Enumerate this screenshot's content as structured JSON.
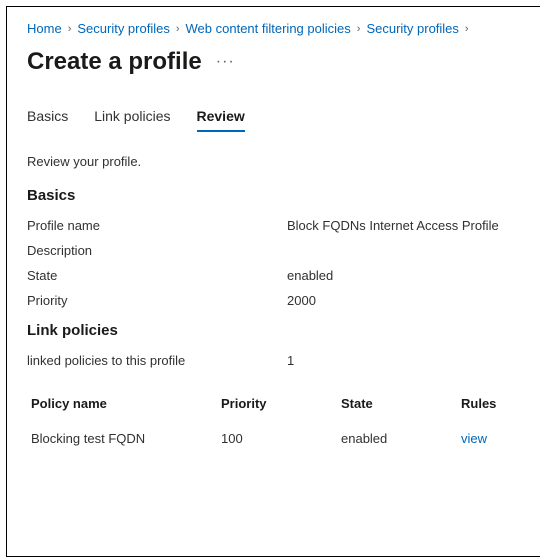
{
  "breadcrumb": {
    "items": [
      {
        "label": "Home"
      },
      {
        "label": "Security profiles"
      },
      {
        "label": "Web content filtering policies"
      },
      {
        "label": "Security profiles"
      }
    ]
  },
  "page": {
    "title": "Create a profile",
    "subtext": "Review your profile."
  },
  "tabs": {
    "items": [
      {
        "label": "Basics"
      },
      {
        "label": "Link policies"
      },
      {
        "label": "Review"
      }
    ]
  },
  "sections": {
    "basics": {
      "heading": "Basics",
      "rows": [
        {
          "k": "Profile name",
          "v": "Block FQDNs Internet Access Profile"
        },
        {
          "k": "Description",
          "v": ""
        },
        {
          "k": "State",
          "v": "enabled"
        },
        {
          "k": "Priority",
          "v": "2000"
        }
      ]
    },
    "link_policies": {
      "heading": "Link policies",
      "summary_label": "linked policies to this profile",
      "summary_value": "1",
      "columns": {
        "name": "Policy name",
        "priority": "Priority",
        "state": "State",
        "rules": "Rules"
      },
      "rows": [
        {
          "name": "Blocking test FQDN",
          "priority": "100",
          "state": "enabled",
          "rules": "view"
        }
      ]
    }
  }
}
